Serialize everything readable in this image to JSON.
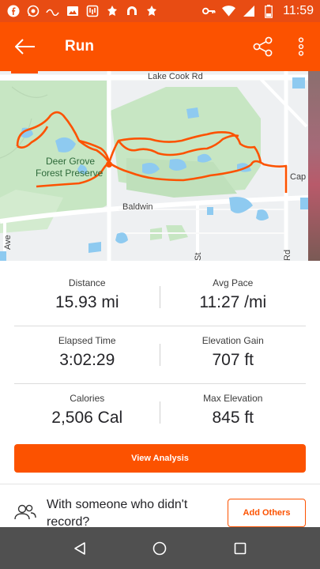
{
  "status_bar": {
    "time": "11:59",
    "icons_left": [
      "facebook-icon",
      "whatsapp-icon",
      "wave-icon",
      "image-icon",
      "app-icon",
      "app-icon",
      "arch-icon",
      "app-icon"
    ],
    "icons_right": [
      "key-icon",
      "wifi-icon",
      "signal-icon",
      "battery-icon"
    ]
  },
  "app_bar": {
    "title": "Run",
    "back_icon": "arrow-left-icon",
    "share_icon": "share-icon",
    "menu_icon": "more-vertical-icon"
  },
  "map": {
    "labels": {
      "lake_cook": "Lake Cook Rd",
      "deer_grove": "Deer Grove",
      "forest_preserve": "Forest Preserve",
      "baldwin": "Baldwin",
      "cap": "Cap",
      "ave": "Ave",
      "st": "St",
      "rd": "Rd"
    },
    "colors": {
      "route": "#fc5200",
      "park": "#c7e6c3",
      "water": "#8ecaf0"
    }
  },
  "stats": [
    {
      "left": {
        "label": "Distance",
        "value": "15.93 mi"
      },
      "right": {
        "label": "Avg Pace",
        "value": "11:27 /mi"
      }
    },
    {
      "left": {
        "label": "Elapsed Time",
        "value": "3:02:29"
      },
      "right": {
        "label": "Elevation Gain",
        "value": "707 ft"
      }
    },
    {
      "left": {
        "label": "Calories",
        "value": "2,506 Cal"
      },
      "right": {
        "label": "Max Elevation",
        "value": "845 ft"
      }
    }
  ],
  "analysis_button": "View Analysis",
  "others": {
    "icon": "people-icon",
    "text": "With someone who didn't record?",
    "button": "Add Others"
  },
  "nav_bar": {
    "icons": [
      "back-triangle-icon",
      "home-circle-icon",
      "recents-square-icon"
    ]
  },
  "colors": {
    "accent": "#fc5200",
    "status_bar": "#e84c13",
    "nav_bar": "#505050"
  }
}
